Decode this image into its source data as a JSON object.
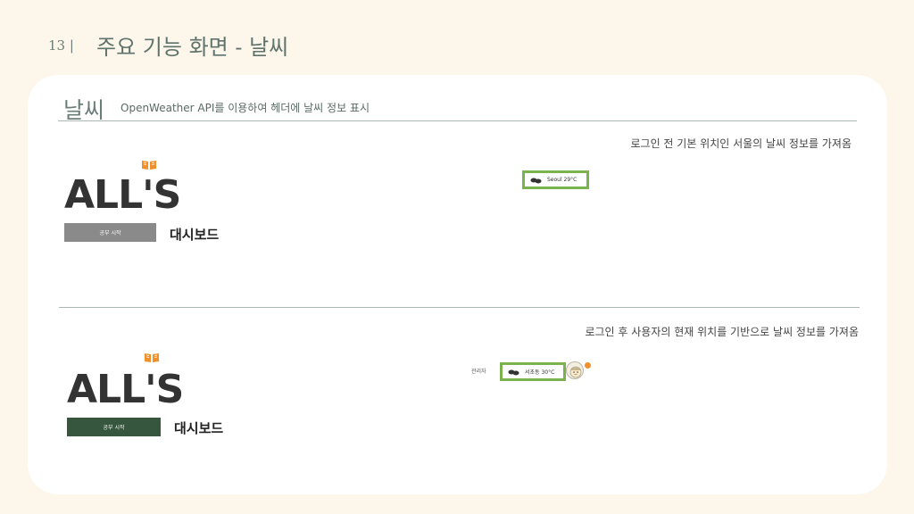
{
  "header": {
    "page_number": "13 |",
    "title": "주요 기능 화면 - 날씨"
  },
  "section": {
    "title": "날씨",
    "description": "OpenWeather API를 이용하여 헤더에 날씨 정보 표시"
  },
  "top_example": {
    "caption": "로그인 전 기본 위치인 서울의 날씨 정보를 가져옴",
    "logo_text": "ALL'S",
    "start_button": "공부 시작",
    "dashboard_label": "대시보드",
    "weather_text": "Seoul 29°C"
  },
  "bottom_example": {
    "caption": "로그인 후 사용자의 현재 위치를 기반으로 날씨 정보를 가져옴",
    "logo_text": "ALL'S",
    "start_button": "공부 시작",
    "dashboard_label": "대시보드",
    "admin_label": "관리자",
    "weather_text": "서초동 30°C"
  },
  "colors": {
    "background": "#fdf6ea",
    "card": "#ffffff",
    "highlight_border": "#7ab24e",
    "button_gray": "#8a8a8a",
    "button_green": "#36563d",
    "accent_orange": "#f0902a"
  },
  "icons": [
    "book-icon",
    "cloud-icon",
    "avatar-icon",
    "notification-dot-icon"
  ]
}
